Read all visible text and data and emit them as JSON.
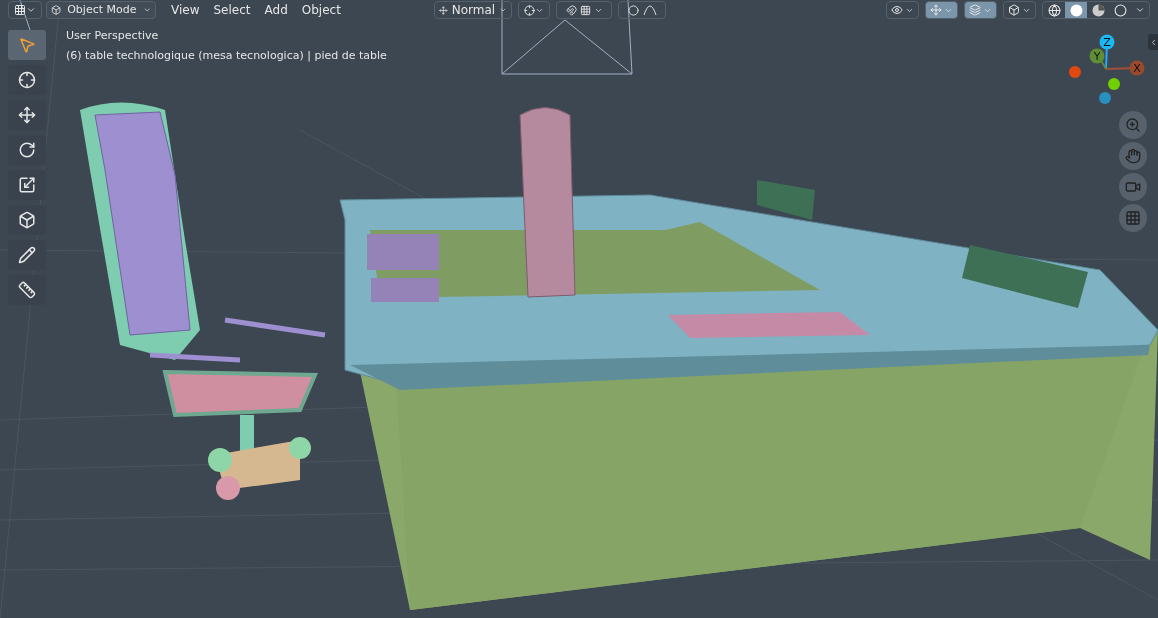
{
  "header": {
    "mode": "Object Mode",
    "menus": [
      "View",
      "Select",
      "Add",
      "Object"
    ],
    "orientation": "Normal",
    "toggles": [
      {
        "kind": "visibility",
        "on": false
      },
      {
        "kind": "gizmo",
        "on": true
      },
      {
        "kind": "overlay",
        "on": true
      },
      {
        "kind": "xray",
        "on": false
      }
    ],
    "shading": [
      {
        "kind": "wireframe",
        "selected": false
      },
      {
        "kind": "solid",
        "selected": true
      },
      {
        "kind": "material",
        "selected": false
      },
      {
        "kind": "rendered",
        "selected": false
      }
    ]
  },
  "toolbar": [
    {
      "kind": "select",
      "selected": true
    },
    {
      "kind": "cursor",
      "selected": false
    },
    {
      "kind": "move",
      "selected": false
    },
    {
      "kind": "rotate",
      "selected": false
    },
    {
      "kind": "scale",
      "selected": false
    },
    {
      "kind": "transform",
      "selected": false
    },
    {
      "kind": "annotate",
      "selected": false
    },
    {
      "kind": "measure",
      "selected": false
    }
  ],
  "overlay_text": {
    "view": "User Perspective",
    "object": "(6) table technologique (mesa tecnologica) | pied de table"
  },
  "axes": {
    "z": "Z",
    "y": "Y",
    "x": "X"
  },
  "navigation": [
    {
      "kind": "zoom"
    },
    {
      "kind": "pan"
    },
    {
      "kind": "camera"
    },
    {
      "kind": "ortho"
    }
  ]
}
